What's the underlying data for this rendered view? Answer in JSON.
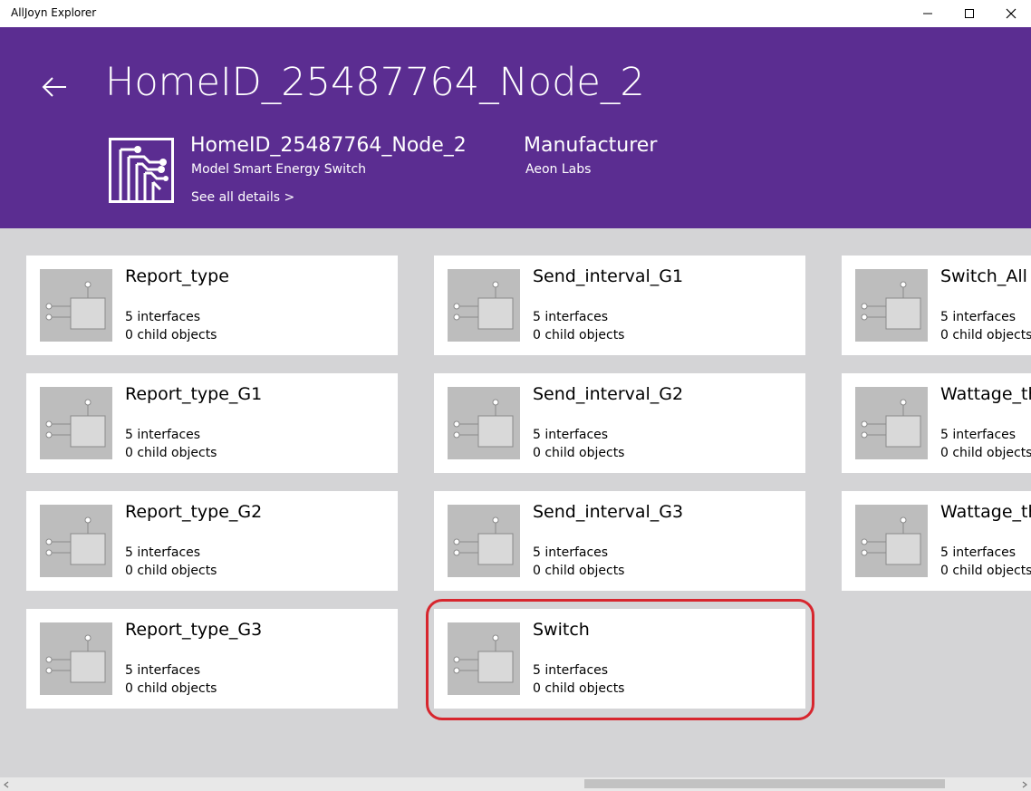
{
  "window": {
    "title": "AllJoyn Explorer",
    "minimize_icon": "minimize-icon",
    "maximize_icon": "maximize-icon",
    "close_icon": "close-icon"
  },
  "header": {
    "back_icon": "back-arrow-icon",
    "page_title": "HomeID_25487764_Node_2",
    "device": {
      "logo_icon": "circuit-board-icon",
      "name": "HomeID_25487764_Node_2",
      "model": "Model Smart Energy Switch",
      "see_all_details": "See all details >"
    },
    "manufacturer": {
      "label": "Manufacturer",
      "value": "Aeon Labs"
    },
    "background_color": "#5b2d91"
  },
  "objects": [
    {
      "name": "Report_type",
      "interfaces": "5 interfaces",
      "children": "0 child objects"
    },
    {
      "name": "Report_type_G1",
      "interfaces": "5 interfaces",
      "children": "0 child objects"
    },
    {
      "name": "Report_type_G2",
      "interfaces": "5 interfaces",
      "children": "0 child objects"
    },
    {
      "name": "Report_type_G3",
      "interfaces": "5 interfaces",
      "children": "0 child objects"
    },
    {
      "name": "Send_interval_G1",
      "interfaces": "5 interfaces",
      "children": "0 child objects"
    },
    {
      "name": "Send_interval_G2",
      "interfaces": "5 interfaces",
      "children": "0 child objects"
    },
    {
      "name": "Send_interval_G3",
      "interfaces": "5 interfaces",
      "children": "0 child objects"
    },
    {
      "name": "Switch",
      "interfaces": "5 interfaces",
      "children": "0 child objects",
      "highlighted": true
    },
    {
      "name": "Switch_All",
      "interfaces": "5 interfaces",
      "children": "0 child objects"
    },
    {
      "name": "Wattage_th",
      "interfaces": "5 interfaces",
      "children": "0 child objects"
    },
    {
      "name": "Wattage_th",
      "interfaces": "5 interfaces",
      "children": "0 child objects"
    }
  ],
  "object_icon": "bus-object-icon",
  "highlight_color": "#d7262e",
  "scrollbar": {
    "left_icon": "scroll-left-icon",
    "right_icon": "scroll-right-icon"
  }
}
